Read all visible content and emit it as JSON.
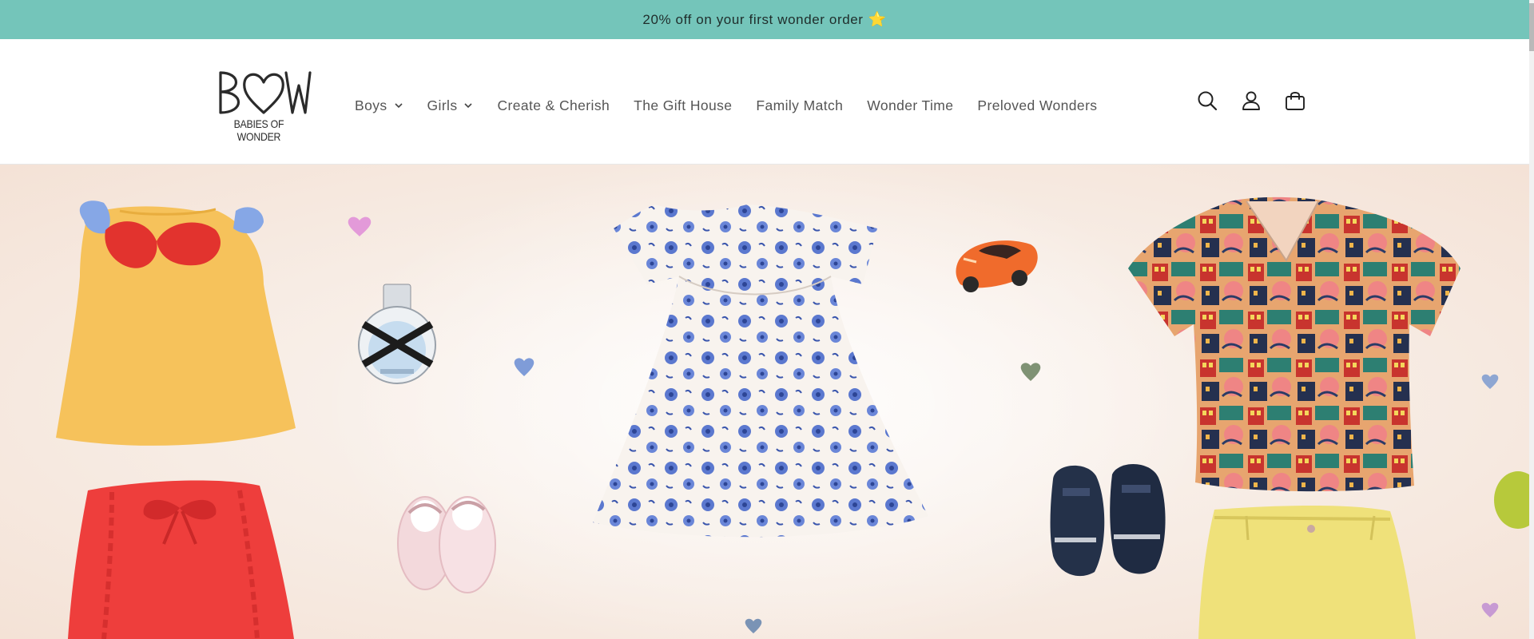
{
  "announcement": {
    "text": "20% off on your first wonder order",
    "icon": "star-icon"
  },
  "logo": {
    "letters": "BOW",
    "tagline": "BABIES OF WONDER"
  },
  "nav": {
    "items": [
      {
        "label": "Boys",
        "has_dropdown": true
      },
      {
        "label": "Girls",
        "has_dropdown": true
      },
      {
        "label": "Create & Cherish",
        "has_dropdown": false
      },
      {
        "label": "The Gift House",
        "has_dropdown": false
      },
      {
        "label": "Family Match",
        "has_dropdown": false
      },
      {
        "label": "Wonder Time",
        "has_dropdown": false
      },
      {
        "label": "Preloved Wonders",
        "has_dropdown": false
      }
    ]
  },
  "header_icons": [
    "search-icon",
    "account-icon",
    "cart-icon"
  ],
  "colors": {
    "announcement_bg": "#74c5ba",
    "header_bg": "#ffffff",
    "nav_text": "#555555"
  }
}
